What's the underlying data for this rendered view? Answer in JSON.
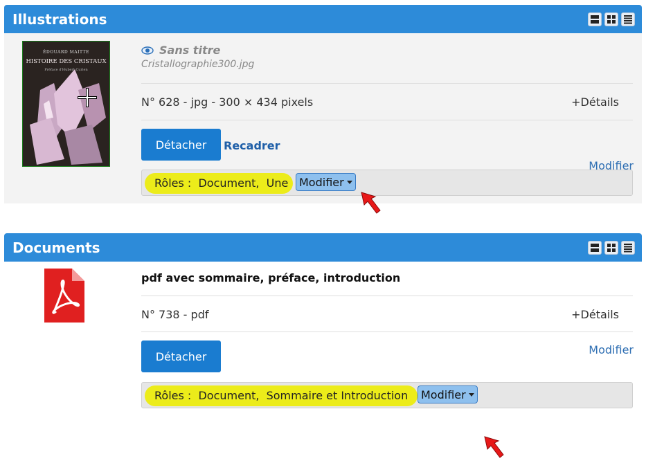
{
  "illustrations": {
    "title": "Illustrations",
    "thumb": {
      "author": "ÉDOUARD MAITTE",
      "book_title": "HISTOIRE DES CRISTAUX",
      "subtitle": "Préface d'Hubert Curien"
    },
    "item_title": "Sans titre",
    "filename": "Cristallographie300.jpg",
    "meta": "N° 628 - jpg - 300 × 434 pixels",
    "details": "+Détails",
    "detach": "Détacher",
    "recadrer": "Recadrer",
    "modifier": "Modifier",
    "roles": "Rôles :  Document,  Une",
    "roles_modifier": "Modifier"
  },
  "documents": {
    "title": "Documents",
    "doc_title": "pdf avec sommaire, préface, introduction",
    "meta": "N° 738 - pdf",
    "details": "+Détails",
    "detach": "Détacher",
    "modifier": "Modifier",
    "roles": "Rôles :  Document,  Sommaire et Introduction",
    "roles_modifier": "Modifier"
  },
  "colors": {
    "header": "#2d8bd9",
    "button": "#1a7cd0",
    "highlight": "#ecec1a",
    "pointer": "#e81818",
    "pdf_icon": "#e02020"
  },
  "icons": [
    "view-list-icon",
    "view-grid-icon",
    "view-rows-icon",
    "eye-icon",
    "pdf-icon",
    "red-pointer-arrow"
  ]
}
